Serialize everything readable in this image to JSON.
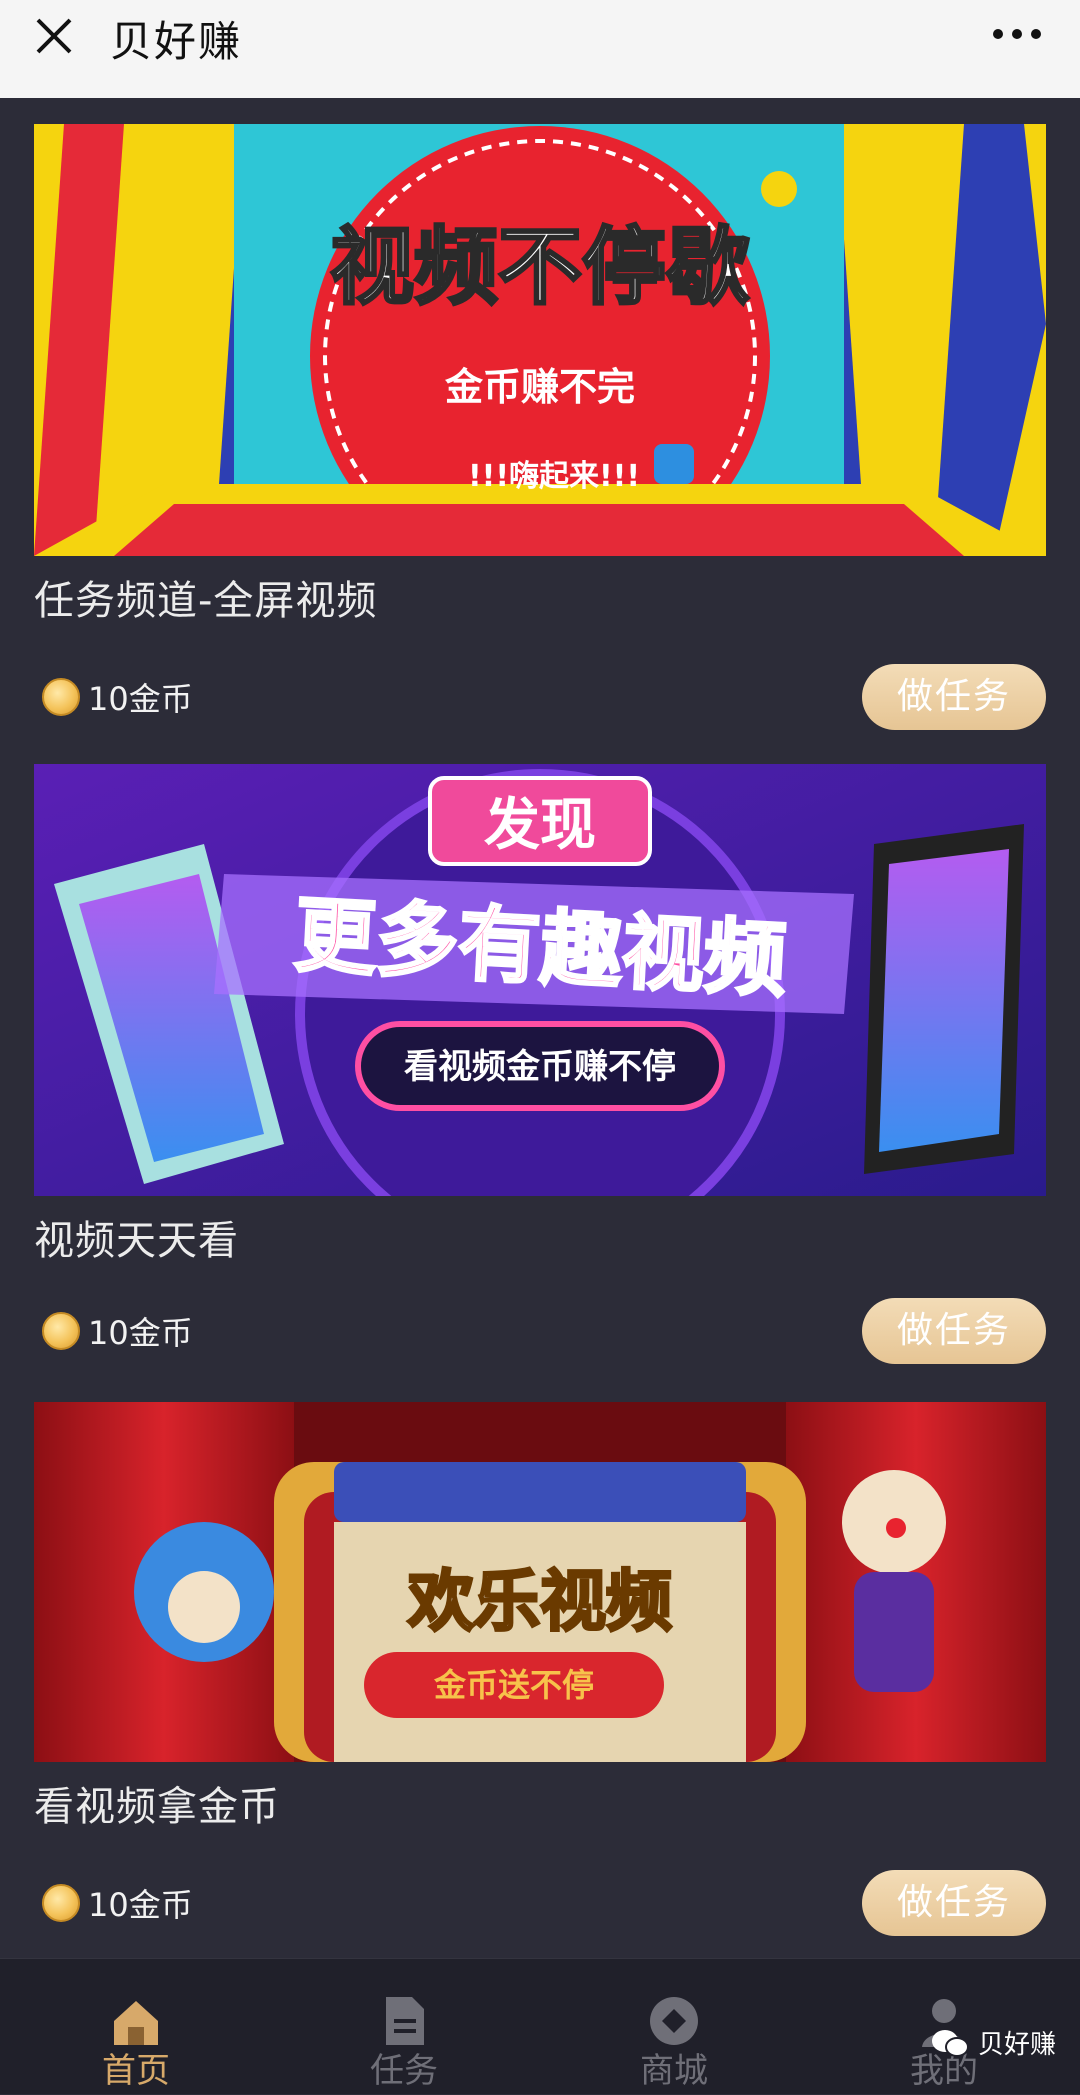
{
  "topbar": {
    "title": "贝好赚",
    "close_icon": "close-icon",
    "more_icon": "more-horizontal-icon"
  },
  "tasks": [
    {
      "title": "任务频道-全屏视频",
      "reward": "10金币",
      "button": "做任务",
      "banner": {
        "headline": "视频不停歇",
        "subline": "金币赚不完",
        "tagline": "!!!嗨起来!!!"
      }
    },
    {
      "title": "视频天天看",
      "reward": "10金币",
      "button": "做任务",
      "banner": {
        "badge": "发现",
        "headline": "更多有趣视频",
        "subline": "看视频金币赚不停"
      }
    },
    {
      "title": "看视频拿金币",
      "reward": "10金币",
      "button": "做任务",
      "banner": {
        "headline": "欢乐视频",
        "subline": "金币送不停"
      }
    }
  ],
  "tabbar": {
    "tabs": [
      {
        "label": "首页",
        "icon": "home-icon",
        "active": true
      },
      {
        "label": "任务",
        "icon": "document-icon",
        "active": false
      },
      {
        "label": "商城",
        "icon": "shop-icon",
        "active": false
      },
      {
        "label": "我的",
        "icon": "user-icon",
        "active": false
      }
    ]
  },
  "watermark": {
    "text": "贝好赚",
    "icon": "wechat-icon"
  },
  "colors": {
    "background": "#2c2c38",
    "accent": "#d7a96a",
    "button": "#e9cb9c"
  }
}
